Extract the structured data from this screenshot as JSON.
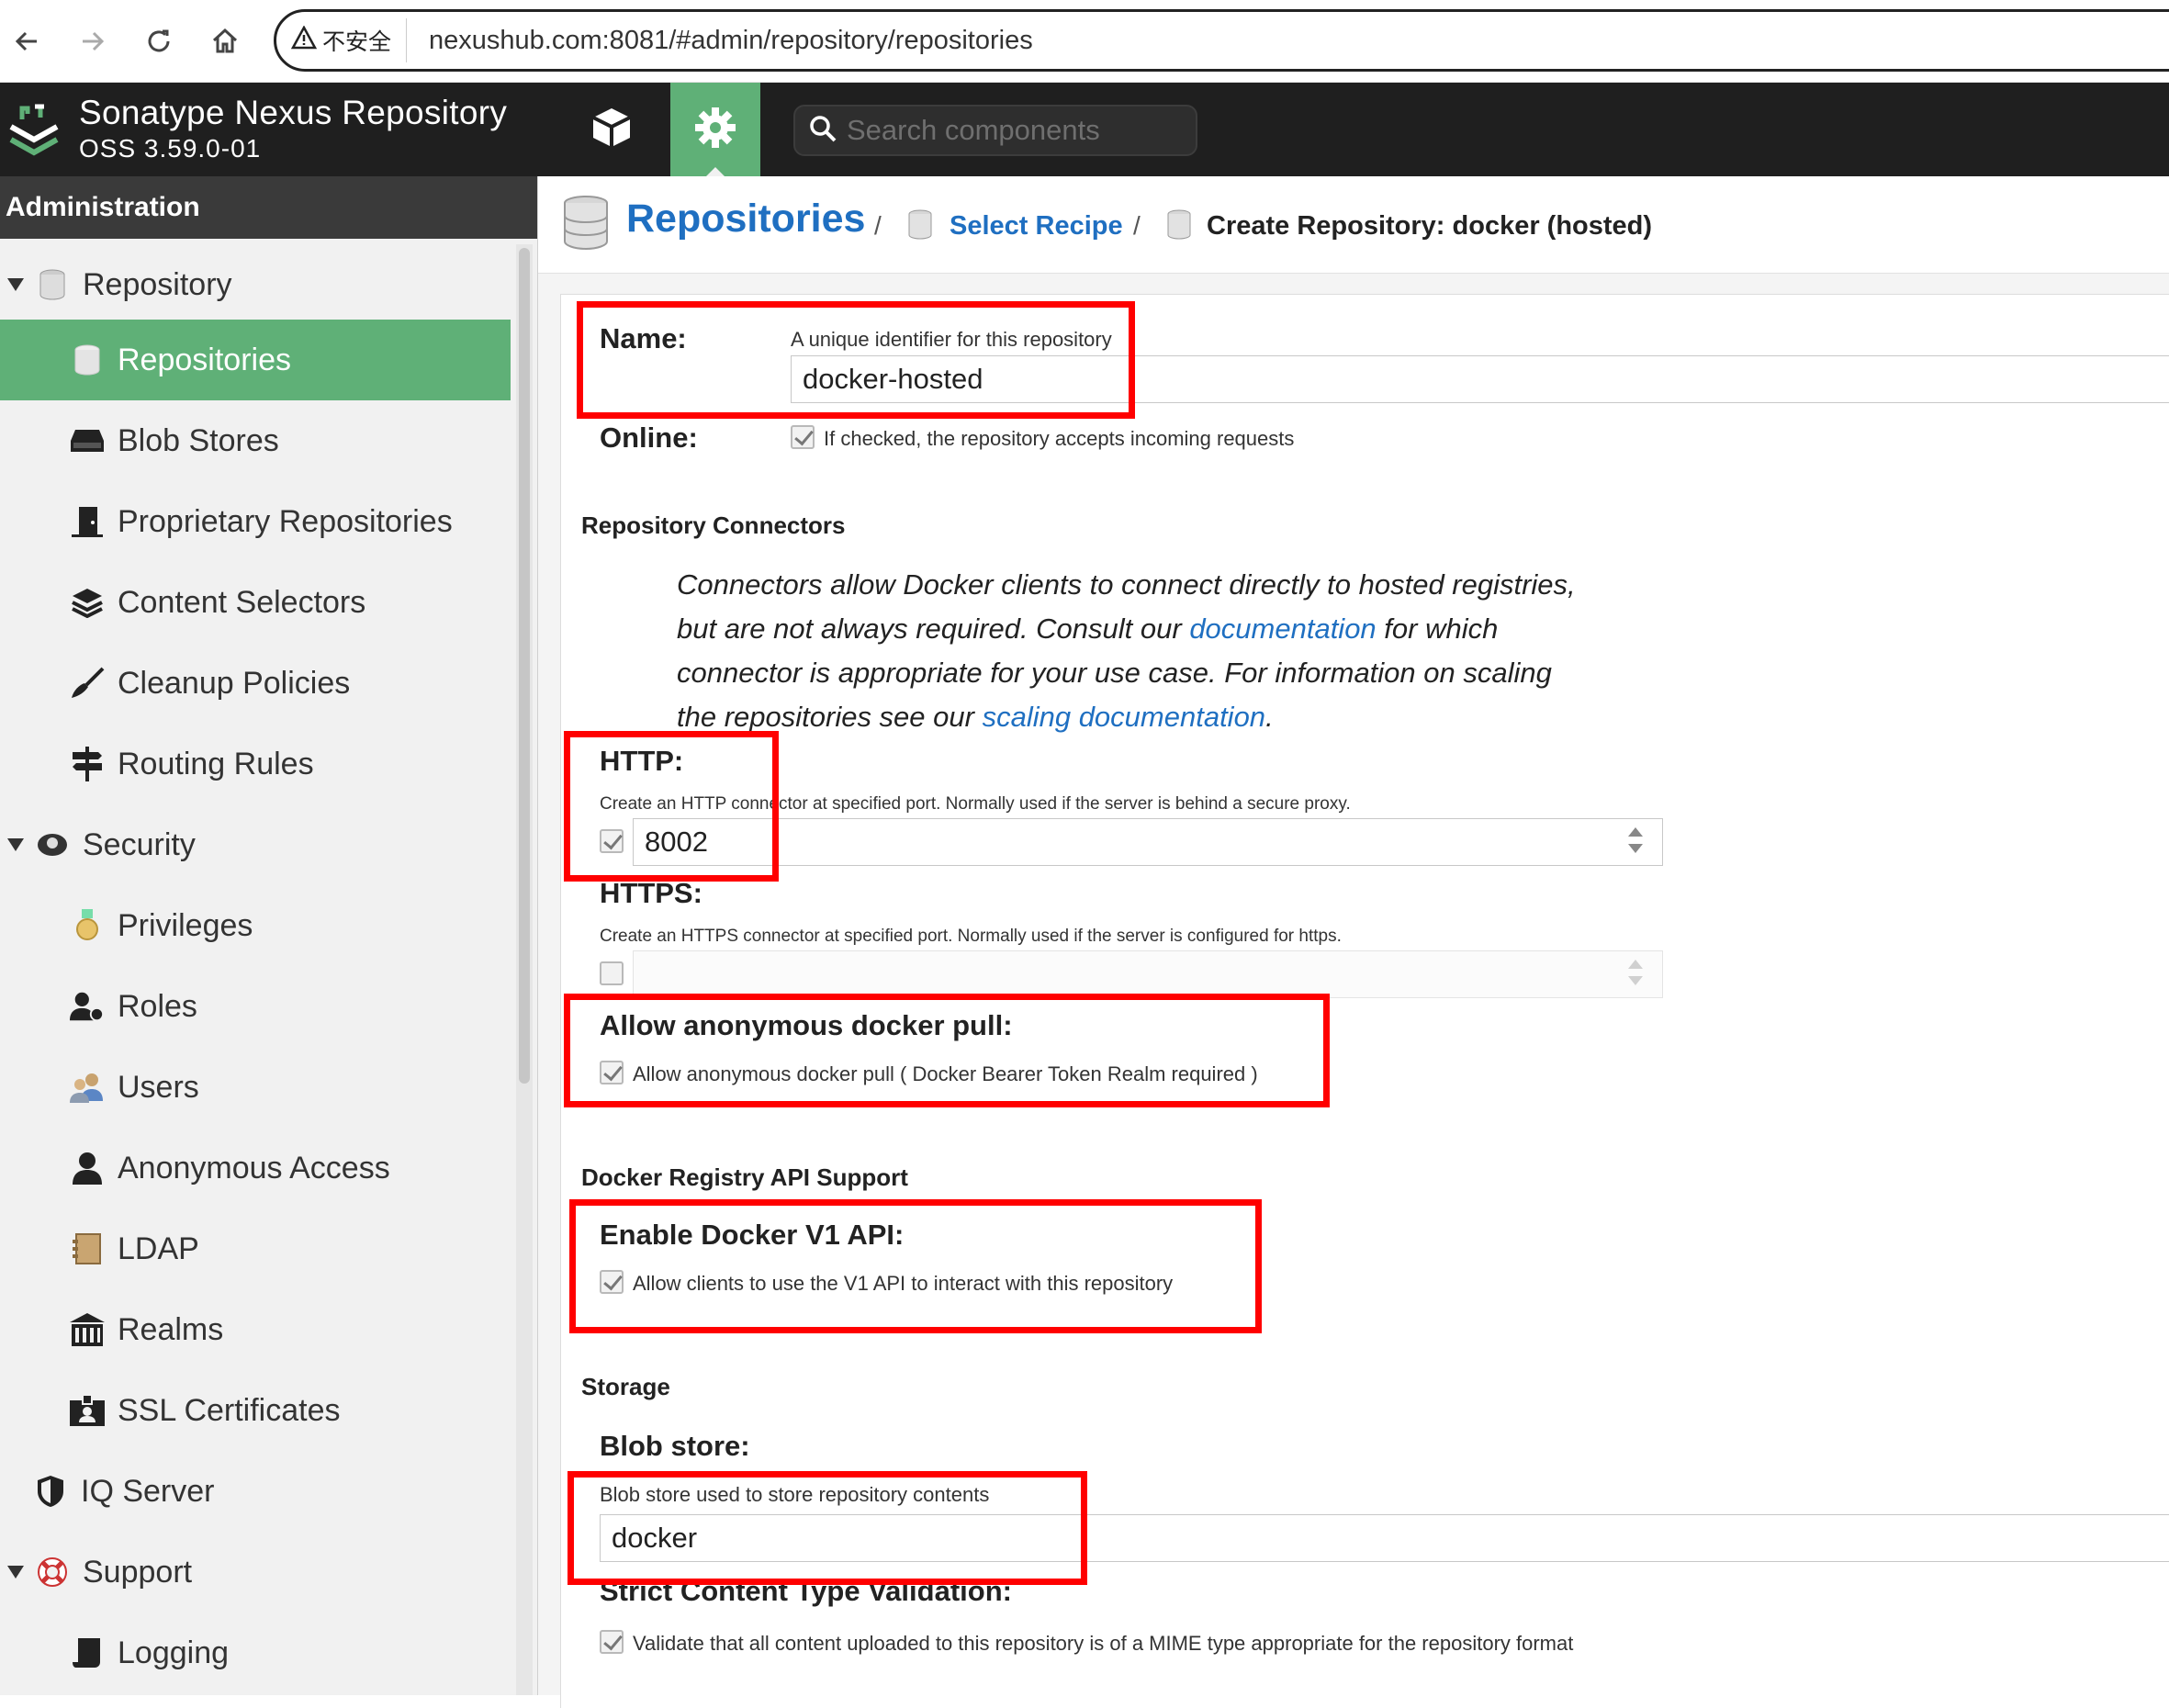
{
  "browser": {
    "security_label": "不安全",
    "url": "nexushub.com:8081/#admin/repository/repositories"
  },
  "header": {
    "title": "Sonatype Nexus Repository",
    "version": "OSS 3.59.0-01",
    "search_placeholder": "Search components"
  },
  "sidebar": {
    "title": "Administration",
    "items": [
      {
        "label": "Repository"
      },
      {
        "label": "Repositories"
      },
      {
        "label": "Blob Stores"
      },
      {
        "label": "Proprietary Repositories"
      },
      {
        "label": "Content Selectors"
      },
      {
        "label": "Cleanup Policies"
      },
      {
        "label": "Routing Rules"
      },
      {
        "label": "Security"
      },
      {
        "label": "Privileges"
      },
      {
        "label": "Roles"
      },
      {
        "label": "Users"
      },
      {
        "label": "Anonymous Access"
      },
      {
        "label": "LDAP"
      },
      {
        "label": "Realms"
      },
      {
        "label": "SSL Certificates"
      },
      {
        "label": "IQ Server"
      },
      {
        "label": "Support"
      },
      {
        "label": "Logging"
      }
    ]
  },
  "breadcrumb": {
    "root": "Repositories",
    "sep": "/",
    "recipe": "Select Recipe",
    "current": "Create Repository: docker (hosted)"
  },
  "form": {
    "name": {
      "label": "Name:",
      "help": "A unique identifier for this repository",
      "value": "docker-hosted"
    },
    "online": {
      "label": "Online:",
      "help": "If checked, the repository accepts incoming requests",
      "checked": true
    },
    "connectors": {
      "title": "Repository Connectors",
      "desc_1": "Connectors allow Docker clients to connect directly to hosted registries, but are not always required. Consult our ",
      "desc_link_1": "documentation",
      "desc_2": " for which connector is appropriate for your use case. For information on scaling the repositories see our ",
      "desc_link_2": "scaling documentation",
      "desc_3": "."
    },
    "http": {
      "label": "HTTP:",
      "help": "Create an HTTP connector at specified port. Normally used if the server is behind a secure proxy.",
      "value": "8002",
      "checked": true
    },
    "https": {
      "label": "HTTPS:",
      "help": "Create an HTTPS connector at specified port. Normally used if the server is configured for https.",
      "value": "",
      "checked": false
    },
    "anonymous_pull": {
      "label": "Allow anonymous docker pull:",
      "help": "Allow anonymous docker pull ( Docker Bearer Token Realm required )",
      "checked": true
    },
    "api_support": {
      "title": "Docker Registry API Support"
    },
    "v1_api": {
      "label": "Enable Docker V1 API:",
      "help": "Allow clients to use the V1 API to interact with this repository",
      "checked": true
    },
    "storage": {
      "title": "Storage"
    },
    "blob_store": {
      "label": "Blob store:",
      "help": "Blob store used to store repository contents",
      "value": "docker"
    },
    "strict_validation": {
      "label": "Strict Content Type Validation:",
      "help": "Validate that all content uploaded to this repository is of a MIME type appropriate for the repository format",
      "checked": true
    }
  },
  "colors": {
    "accent_green": "#5fb077",
    "link_blue": "#1f6fc1",
    "highlight_red": "#ff0000",
    "header_dark": "#1f1f1f"
  }
}
